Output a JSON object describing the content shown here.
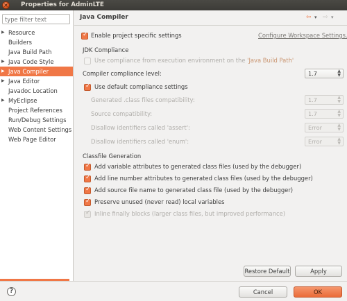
{
  "window": {
    "title": "Properties for AdminLTE"
  },
  "sidebar": {
    "filter_placeholder": "type filter text",
    "items": [
      {
        "label": "Resource",
        "arrow": "▶"
      },
      {
        "label": "Builders",
        "arrow": ""
      },
      {
        "label": "Java Build Path",
        "arrow": ""
      },
      {
        "label": "Java Code Style",
        "arrow": "▶"
      },
      {
        "label": "Java Compiler",
        "arrow": "▶"
      },
      {
        "label": "Java Editor",
        "arrow": "▶"
      },
      {
        "label": "Javadoc Location",
        "arrow": ""
      },
      {
        "label": "MyEclipse",
        "arrow": "▶"
      },
      {
        "label": "Project References",
        "arrow": ""
      },
      {
        "label": "Run/Debug Settings",
        "arrow": ""
      },
      {
        "label": "Web Content Settings",
        "arrow": ""
      },
      {
        "label": "Web Page Editor",
        "arrow": ""
      }
    ],
    "selected": "Java Compiler"
  },
  "page": {
    "title": "Java Compiler",
    "nav": {
      "back": "⇦",
      "back_menu": "▾",
      "forward": "⇨",
      "forward_menu": "▾"
    },
    "enable_specific": "Enable project specific settings",
    "configure_link": "Configure Workspace Settings...",
    "jdk_group": "JDK Compliance",
    "use_compliance_text": "Use compliance from execution environment on the ",
    "use_compliance_link": "'Java Build Path'",
    "compliance_level_label": "Compiler compliance level:",
    "compliance_level_value": "1.7",
    "use_default_compliance": "Use default compliance settings",
    "generated_compat_label": "Generated .class files compatibility:",
    "generated_compat_value": "1.7",
    "source_compat_label": "Source compatibility:",
    "source_compat_value": "1.7",
    "disallow_assert_label": "Disallow identifiers called 'assert':",
    "disallow_assert_value": "Error",
    "disallow_enum_label": "Disallow identifiers called 'enum':",
    "disallow_enum_value": "Error",
    "classfile_group": "Classfile Generation",
    "add_variable": "Add variable attributes to generated class files (used by the debugger)",
    "add_line_number": "Add line number attributes to generated class files (used by the debugger)",
    "add_source_file": "Add source file name to generated class file (used by the debugger)",
    "preserve_unused": "Preserve unused (never read) local variables",
    "inline_finally": "Inline finally blocks (larger class files, but improved performance)"
  },
  "buttons": {
    "restore_defaults": "Restore Default",
    "apply": "Apply",
    "cancel": "Cancel",
    "ok": "OK",
    "help": "?"
  },
  "colors": {
    "accent": "#f07746",
    "titlebar": "#3c3b37"
  }
}
